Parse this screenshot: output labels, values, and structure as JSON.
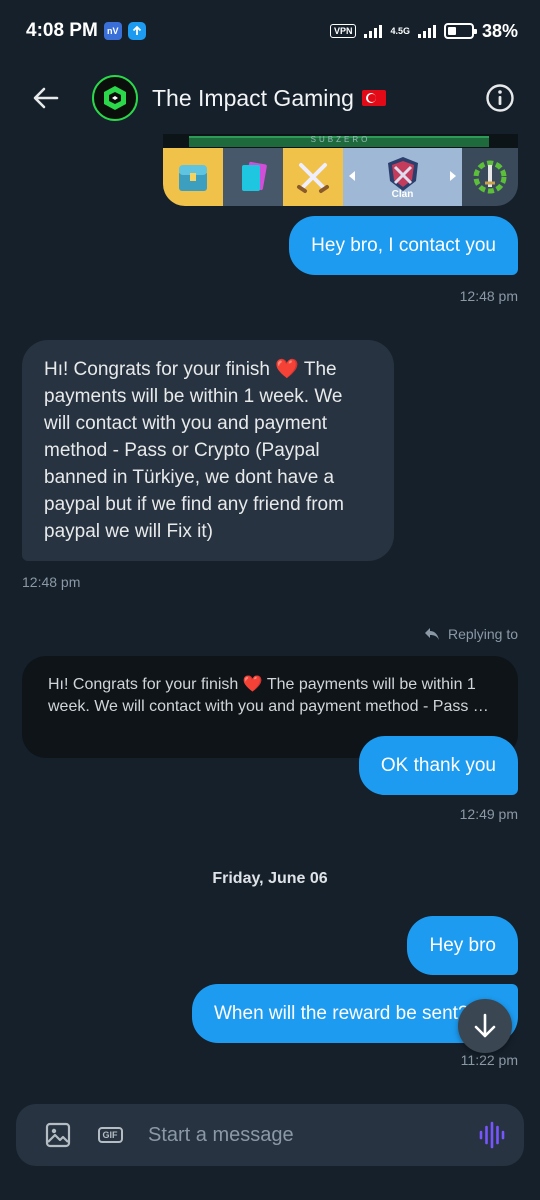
{
  "status_bar": {
    "time": "4:08 PM",
    "badge1": "nV",
    "vpn": "VPN",
    "network": "4.5G",
    "battery_level": 0.38,
    "battery": "38%"
  },
  "header": {
    "title": "The Impact Gaming",
    "flag": "turkey-flag"
  },
  "game_strip": {
    "top_label": "SUBZERO",
    "clan_label": "Clan"
  },
  "messages": [
    {
      "direction": "out",
      "text": "Hey bro, I contact you",
      "time": "12:48 pm"
    },
    {
      "direction": "in",
      "text_pre": "Hı! Congrats for your finish ",
      "text_post": " The payments will be within 1 week. We will contact with you and payment method - Pass or Crypto (Paypal banned in Türkiye, we dont have a paypal but if we find any friend from paypal we will Fix it)",
      "time": "12:48 pm"
    },
    {
      "direction": "out",
      "replying_label": "Replying to",
      "quote_pre": "Hı! Congrats for your finish ",
      "quote_post": " The payments will be within 1 week. We will contact with you and payment method - Pass or Crypto",
      "text": "OK thank you",
      "time": "12:49 pm"
    }
  ],
  "day_separator": "Friday, June 06",
  "messages_after": [
    {
      "direction": "out",
      "text": "Hey bro"
    },
    {
      "direction": "out",
      "text": "When will the reward be sent?",
      "time": "11:22 pm"
    }
  ],
  "composer": {
    "gif_label": "GIF",
    "placeholder": "Start a message"
  },
  "colors": {
    "background": "#15202b",
    "outgoing": "#1d9bf0",
    "incoming": "#273340",
    "accent_voice": "#7856ff"
  }
}
